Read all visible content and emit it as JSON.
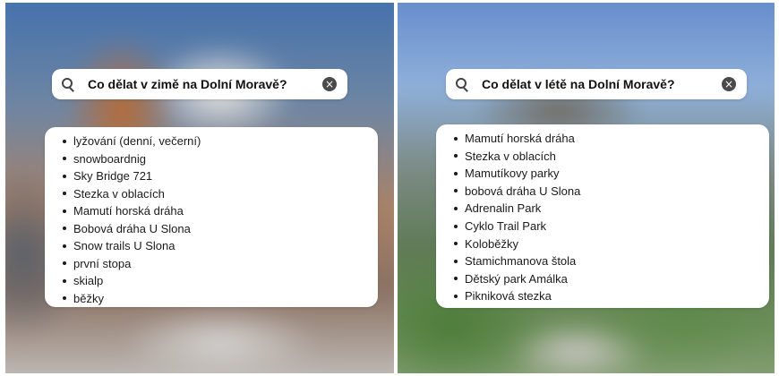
{
  "winter": {
    "search": {
      "query": "Co dělat v zimě na Dolní Moravě?"
    },
    "items": [
      "lyžování (denní, večerní)",
      "snowboardnig",
      "Sky Bridge 721",
      "Stezka v oblacích",
      "Mamutí horská dráha",
      "Bobová dráha U Slona",
      "Snow trails U Slona",
      "první stopa",
      "skialp",
      "běžky"
    ]
  },
  "summer": {
    "search": {
      "query": "Co dělat v létě na Dolní Moravě?"
    },
    "items": [
      "Mamutí horská dráha",
      "Stezka v oblacích",
      "Mamutíkovy parky",
      "bobová dráha U Slona",
      "Adrenalin Park",
      "Cyklo Trail Park",
      "Koloběžky",
      "Stamichmanova štola",
      "Dětský park Amálka",
      "Pikniková stezka"
    ]
  },
  "icons": {
    "search": "search-icon",
    "clear": "close-circle-icon"
  },
  "colors": {
    "card": "#ffffff",
    "text": "#111111",
    "clear_bg": "#4a4a4a"
  }
}
